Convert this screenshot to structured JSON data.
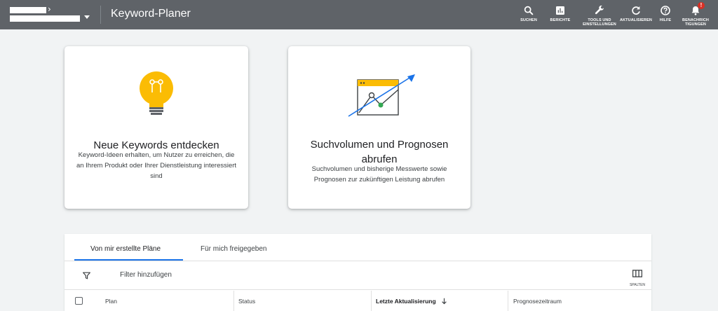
{
  "header": {
    "app_title": "Keyword-Planer",
    "tools": [
      {
        "label": "SUCHEN",
        "icon": "search-icon"
      },
      {
        "label": "BERICHTE",
        "icon": "reports-icon"
      },
      {
        "label": "TOOLS UND EINSTELLUNGEN",
        "icon": "wrench-icon"
      },
      {
        "label": "AKTUALISIEREN",
        "icon": "refresh-icon"
      },
      {
        "label": "HILFE",
        "icon": "help-icon"
      },
      {
        "label": "BENACHRICHTIGUNGEN",
        "icon": "bell-icon",
        "badge": "!"
      }
    ]
  },
  "cards": [
    {
      "title": "Neue Keywords entdecken",
      "description": "Keyword-Ideen erhalten, um Nutzer zu erreichen, die an Ihrem Produkt oder Ihrer Dienstleistung interessiert sind",
      "icon": "lightbulb-icon"
    },
    {
      "title": "Suchvolumen und Prognosen abrufen",
      "description": "Suchvolumen und bisherige Messwerte sowie Prognosen zur zukünftigen Leistung abrufen",
      "icon": "trend-chart-icon"
    }
  ],
  "plans": {
    "tabs": [
      "Von mir erstellte Pläne",
      "Für mich freigegeben"
    ],
    "active_tab": 0,
    "filter_label": "Filter hinzufügen",
    "columns_label": "SPALTEN",
    "columns": [
      "Plan",
      "Status",
      "Letzte Aktualisierung",
      "Prognosezeitraum"
    ],
    "sorted_column": "Letzte Aktualisierung"
  },
  "colors": {
    "topbar": "#5f6368",
    "accent_blue": "#1a73e8",
    "bulb_yellow": "#fbbc04",
    "alert_red": "#d93025",
    "green_point": "#34a853"
  }
}
